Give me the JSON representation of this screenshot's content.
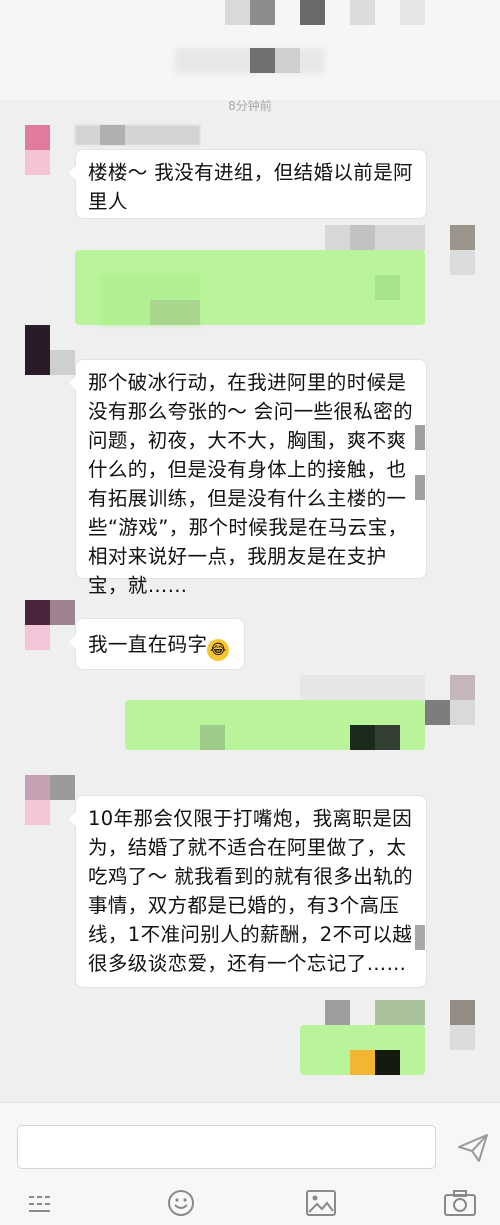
{
  "timestamp": "8分钟前",
  "messages": [
    {
      "id": "m1",
      "dir": "in",
      "text": "楼楼～ 我没有进组，但结婚以前是阿里人"
    },
    {
      "id": "m2",
      "dir": "out"
    },
    {
      "id": "m3",
      "dir": "in",
      "text": "那个破冰行动，在我进阿里的时候是没有那么夸张的～ 会问一些很私密的问题，初夜，大不大，胸围，爽不爽什么的，但是没有身体上的接触，也有拓展训练，但是没有什么主楼的一些“游戏”，那个时候我是在马云宝，相对来说好一点，我朋友是在支护宝，就……"
    },
    {
      "id": "m4",
      "dir": "in",
      "text": "我一直在码字",
      "emoji": "laughing-tears"
    },
    {
      "id": "m5",
      "dir": "out"
    },
    {
      "id": "m6",
      "dir": "in",
      "text": "10年那会仅限于打嘴炮，我离职是因为，结婚了就不适合在阿里做了，太吃鸡了～ 就我看到的就有很多出轨的事情，双方都是已婚的，有3个高压线，1不准问别人的薪酬，2不可以越很多级谈恋爱，还有一个忘记了……"
    },
    {
      "id": "m7",
      "dir": "out"
    }
  ],
  "input": {
    "value": ""
  },
  "toolbar": [
    "keyboard",
    "emoji",
    "image",
    "camera"
  ],
  "colors": {
    "outgoing_bubble": "#b9f49b",
    "background": "#efefef"
  }
}
